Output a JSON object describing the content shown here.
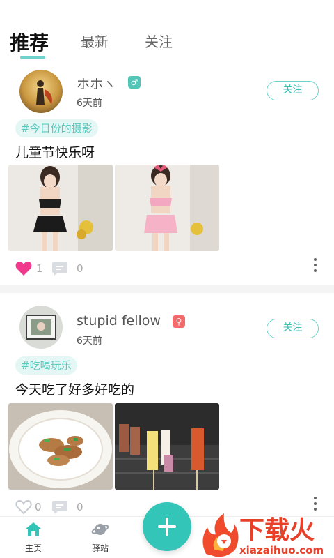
{
  "tabs": [
    {
      "label": "推荐",
      "active": true
    },
    {
      "label": "最新",
      "active": false
    },
    {
      "label": "关注",
      "active": false
    }
  ],
  "accent_color": "#33c6b8",
  "posts": [
    {
      "username": "ホホヽ",
      "gender": "male",
      "gender_color": "#52c7b8",
      "time": "6天前",
      "follow_label": "关注",
      "topic": "#今日份的摄影",
      "text": "儿童节快乐呀",
      "photos": [
        "woman in black frilly bikini",
        "woman in pink frilly bikini"
      ],
      "likes": "1",
      "liked": true,
      "comments": "0"
    },
    {
      "username": "stupid fellow",
      "gender": "female",
      "gender_color": "#f26a6a",
      "time": "6天前",
      "follow_label": "关注",
      "topic": "#吃喝玩乐",
      "text": "今天吃了好多好吃的",
      "photos": [
        "stir-fried meat with green onions",
        "grilled skewers on barbecue"
      ],
      "likes": "0",
      "liked": false,
      "comments": "0"
    }
  ],
  "bottom_nav": {
    "home_label": "主页",
    "station_label": "驿站"
  },
  "watermark": {
    "brand": "下载火",
    "url": "xiazaihuo.com"
  }
}
